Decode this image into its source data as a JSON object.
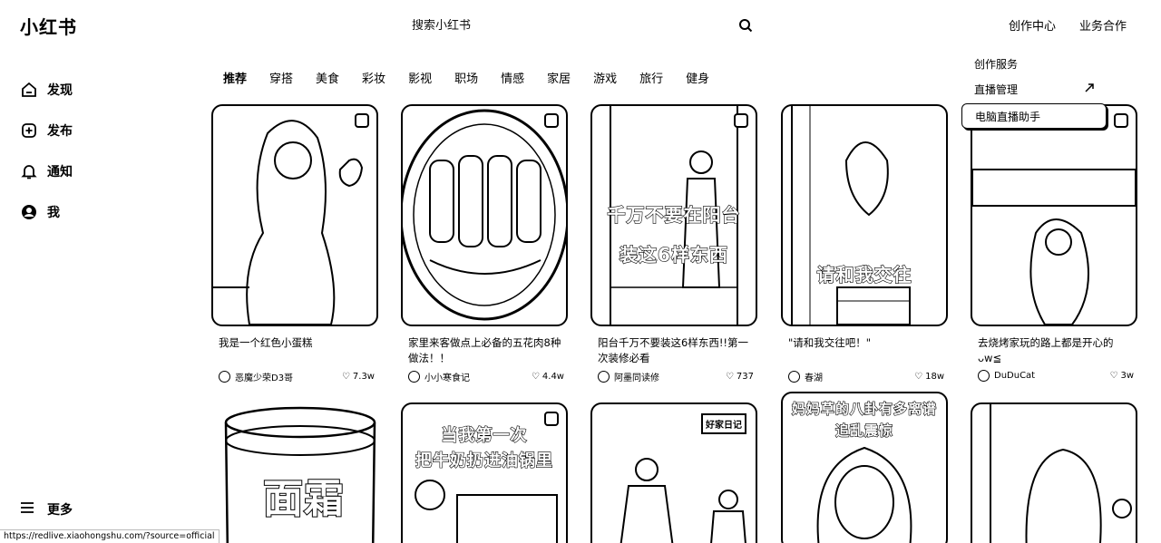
{
  "header": {
    "logo": "小红书",
    "search_placeholder": "搜索小红书",
    "links": [
      "创作中心",
      "业务合作"
    ]
  },
  "sidebar": {
    "items": [
      {
        "label": "发现",
        "icon": "home-icon"
      },
      {
        "label": "发布",
        "icon": "plus-square-icon"
      },
      {
        "label": "通知",
        "icon": "bell-icon"
      },
      {
        "label": "我",
        "icon": "avatar-icon"
      }
    ],
    "more": "更多"
  },
  "status_url": "https://redlive.xiaohongshu.com/?source=official",
  "channels": [
    "推荐",
    "穿搭",
    "美食",
    "彩妆",
    "影视",
    "职场",
    "情感",
    "家居",
    "游戏",
    "旅行",
    "健身"
  ],
  "dropdown": {
    "header": "创作服务",
    "items": [
      "直播管理",
      "电脑直播助手"
    ]
  },
  "cards_row1": [
    {
      "caption": "我是一个红色小蛋糕",
      "author": "恶魔少荣D3哥",
      "likes": "7.3w"
    },
    {
      "caption": "家里来客做点上必备的五花肉8种做法！！",
      "author": "小小寒食记",
      "likes": "4.4w"
    },
    {
      "caption": "阳台千万不要装这6样东西!!第一次装修必看",
      "author": "阿墨同读修",
      "likes": "737",
      "overlay": [
        "千万不要在阳台",
        "装这6样东西"
      ]
    },
    {
      "caption": "\"请和我交往吧！\"",
      "author": "春湖",
      "likes": "18w",
      "overlay": [
        "请和我交往"
      ]
    },
    {
      "caption": "去烧烤家玩的路上都是开心的ᴗw≦",
      "author": "DuDuCat",
      "likes": "3w"
    }
  ],
  "cards_row2": [
    {
      "overlay": [
        "面霜"
      ]
    },
    {
      "overlay": [
        "当我第一次",
        "把牛奶扔进油锅里"
      ]
    },
    {
      "overlay": [
        "好家日记"
      ]
    },
    {
      "overlay": [
        "妈妈草的八卦有多离谱",
        "追乱震惊"
      ]
    },
    {}
  ]
}
